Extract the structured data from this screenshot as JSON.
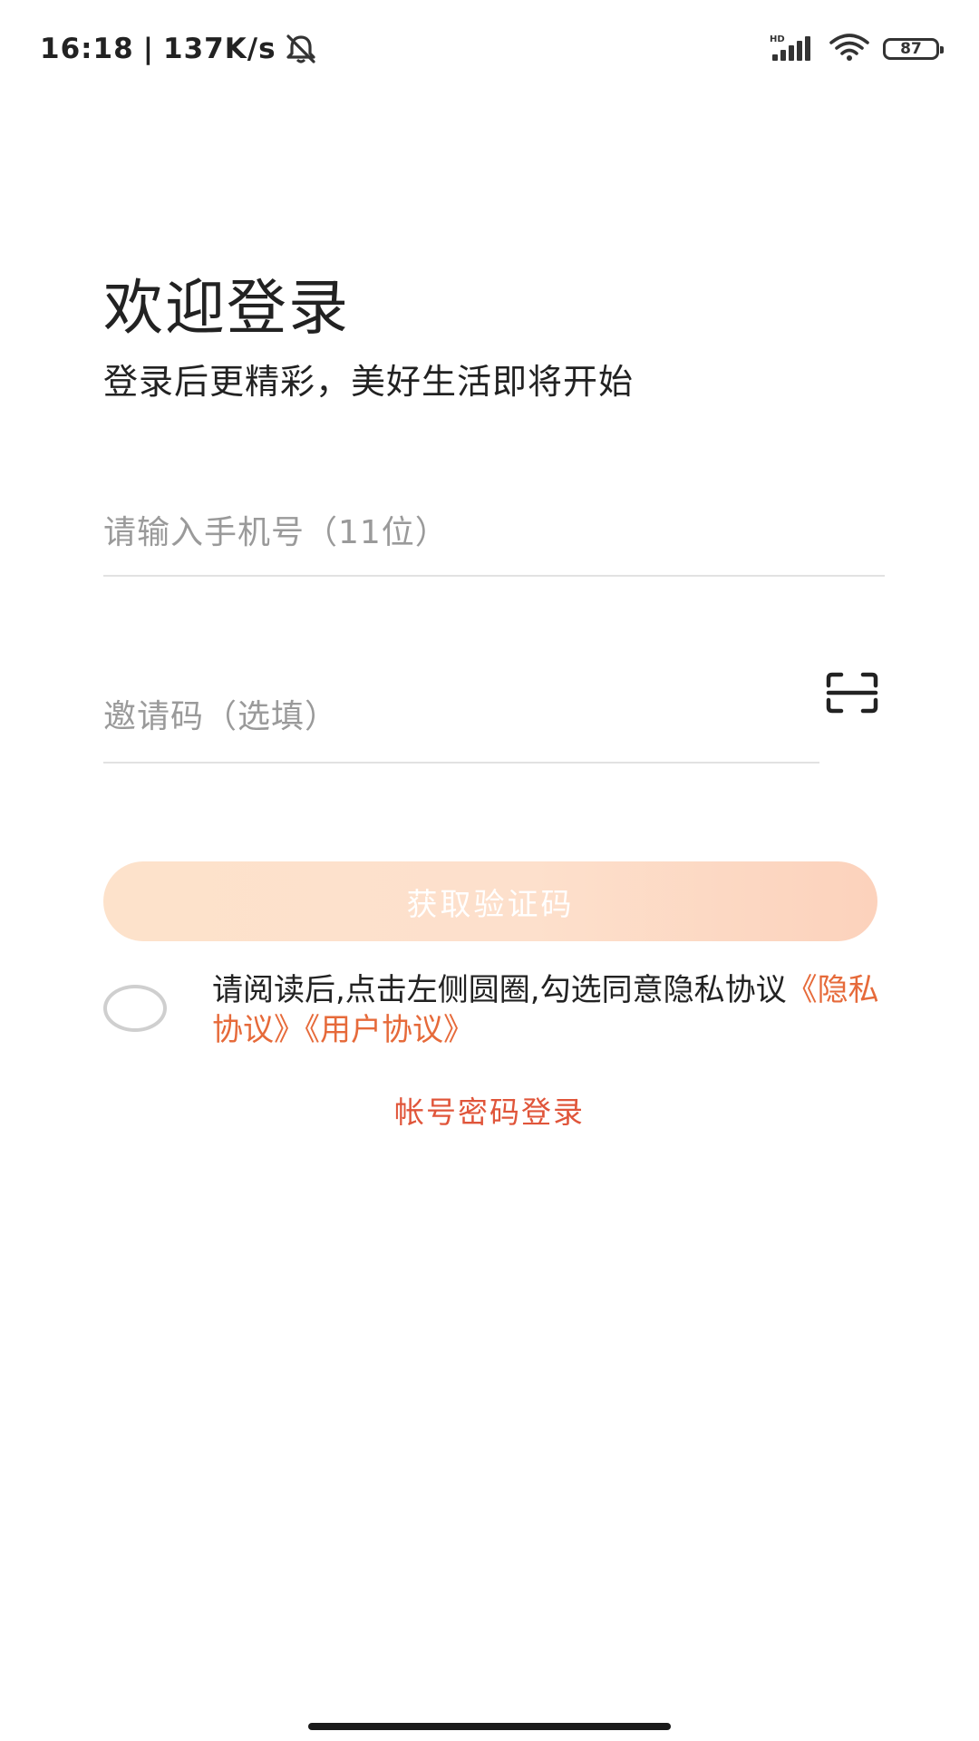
{
  "status_bar": {
    "time": "16:18",
    "separator": "|",
    "net_speed": "137K/s",
    "network_label": "HD",
    "battery": "87"
  },
  "header": {
    "title": "欢迎登录",
    "subtitle": "登录后更精彩，美好生活即将开始"
  },
  "form": {
    "phone_placeholder": "请输入手机号（11位）",
    "phone_value": "",
    "invite_placeholder": "邀请码（选填）",
    "invite_value": "",
    "get_code_label": "获取验证码"
  },
  "agreement": {
    "text": "请阅读后,点击左侧圆圈,勾选同意隐私协议",
    "privacy_link": "《隐私协议》",
    "user_link": "《用户协议》"
  },
  "account_login_label": "帐号密码登录",
  "colors": {
    "accent": "#e66a3a",
    "account_link": "#e0553a",
    "button_gradient_start": "#fde2cb",
    "button_gradient_end": "#fcd2bc"
  },
  "icons": {
    "status_mute": "bell-off-icon",
    "signal": "signal-bars-icon",
    "wifi": "wifi-icon",
    "battery": "battery-icon",
    "scan": "scan-icon"
  }
}
